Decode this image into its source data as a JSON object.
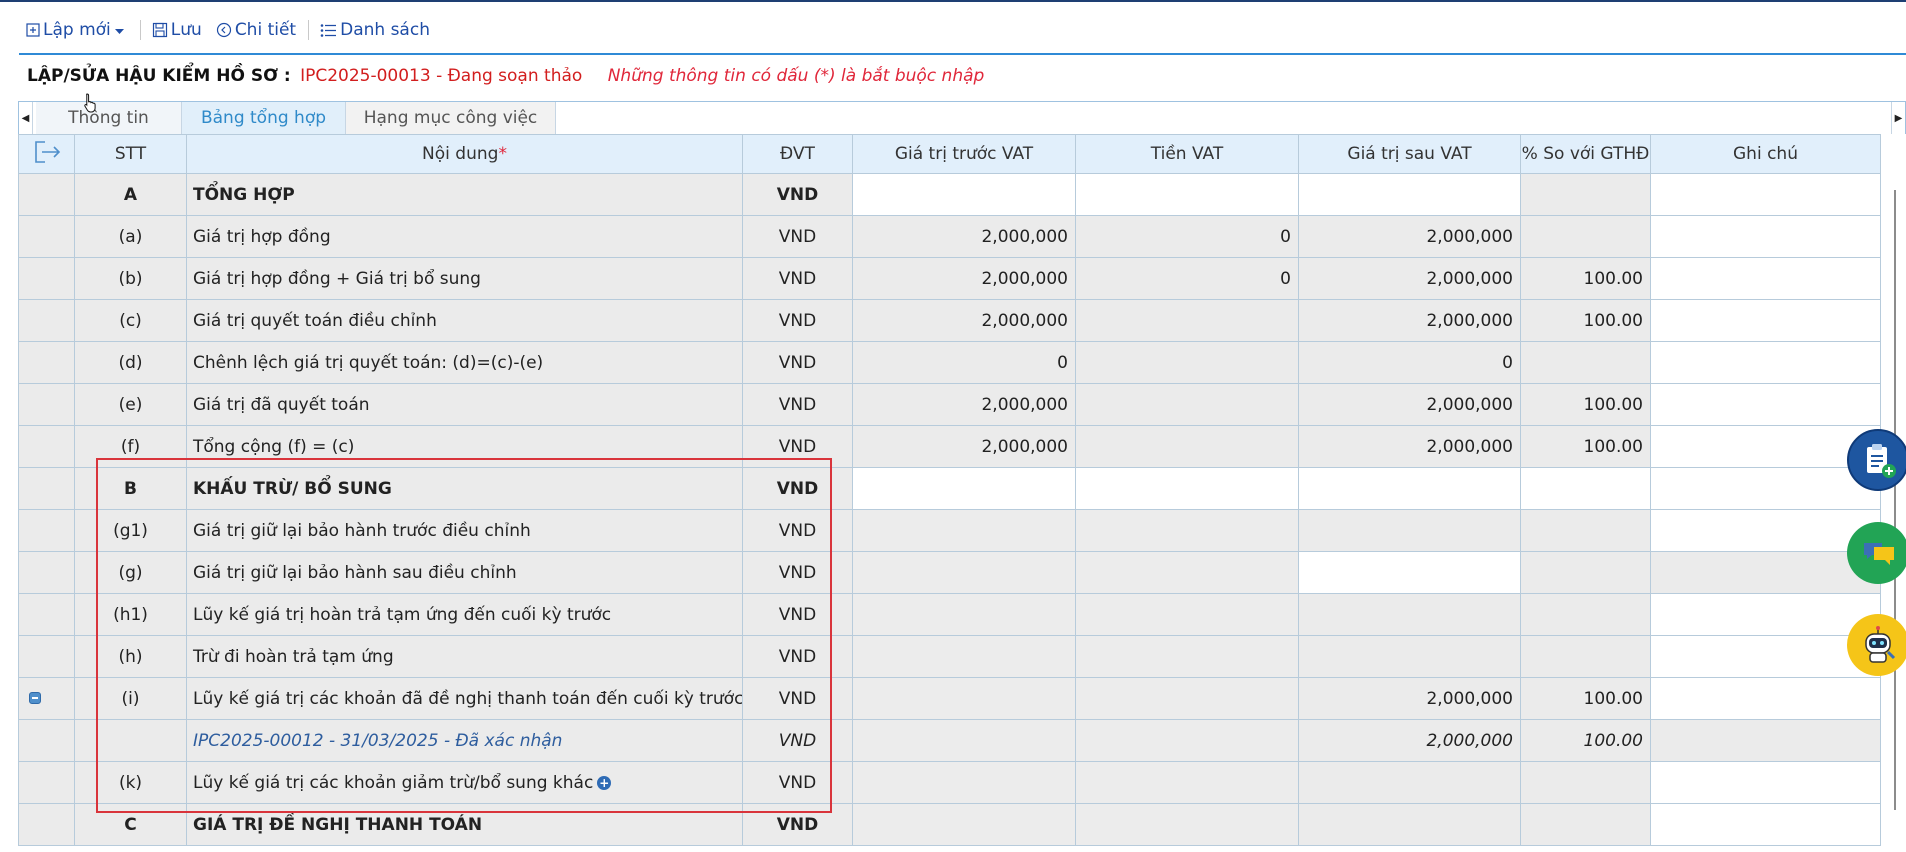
{
  "toolbar": {
    "new_label": "Lập mới",
    "save_label": "Lưu",
    "detail_label": "Chi tiết",
    "list_label": "Danh sách"
  },
  "header": {
    "title": "LẬP/SỬA HẬU KIỂM HỒ SƠ :",
    "record": "IPC2025-00013 - Đang soạn thảo",
    "required_note": "Những thông tin có dấu (*) là bắt buộc nhập"
  },
  "tabs": [
    {
      "label": "Thông tin"
    },
    {
      "label": "Bảng tổng hợp"
    },
    {
      "label": "Hạng mục công việc"
    }
  ],
  "columns": {
    "stt": "STT",
    "content": "Nội dung",
    "required_mark": "*",
    "unit": "ĐVT",
    "pre_vat": "Giá trị trước VAT",
    "vat": "Tiền VAT",
    "post_vat": "Giá trị sau VAT",
    "pct": "% So với GTHĐ",
    "note": "Ghi chú"
  },
  "rows": [
    {
      "stt": "A",
      "content": "TỔNG HỢP",
      "unit": "VND",
      "pre_vat": "",
      "vat": "",
      "post_vat": "",
      "pct": "",
      "note": ""
    },
    {
      "stt": "(a)",
      "content": "Giá trị hợp đồng",
      "unit": "VND",
      "pre_vat": "2,000,000",
      "vat": "0",
      "post_vat": "2,000,000",
      "pct": "",
      "note": ""
    },
    {
      "stt": "(b)",
      "content": "Giá trị hợp đồng + Giá trị bổ sung",
      "unit": "VND",
      "pre_vat": "2,000,000",
      "vat": "0",
      "post_vat": "2,000,000",
      "pct": "100.00",
      "note": ""
    },
    {
      "stt": "(c)",
      "content": "Giá trị quyết toán điều chỉnh",
      "unit": "VND",
      "pre_vat": "2,000,000",
      "vat": "",
      "post_vat": "2,000,000",
      "pct": "100.00",
      "note": ""
    },
    {
      "stt": "(d)",
      "content": "Chênh lệch giá trị quyết toán: (d)=(c)-(e)",
      "unit": "VND",
      "pre_vat": "0",
      "vat": "",
      "post_vat": "0",
      "pct": "",
      "note": ""
    },
    {
      "stt": "(e)",
      "content": "Giá trị đã quyết toán",
      "unit": "VND",
      "pre_vat": "2,000,000",
      "vat": "",
      "post_vat": "2,000,000",
      "pct": "100.00",
      "note": ""
    },
    {
      "stt": "(f)",
      "content": "Tổng cộng (f) = (c)",
      "unit": "VND",
      "pre_vat": "2,000,000",
      "vat": "",
      "post_vat": "2,000,000",
      "pct": "100.00",
      "note": ""
    },
    {
      "stt": "B",
      "content": "KHẤU TRỪ/ BỔ SUNG",
      "unit": "VND",
      "pre_vat": "",
      "vat": "",
      "post_vat": "",
      "pct": "",
      "note": ""
    },
    {
      "stt": "(g1)",
      "content": "Giá trị giữ lại bảo hành trước điều chỉnh",
      "unit": "VND",
      "pre_vat": "",
      "vat": "",
      "post_vat": "",
      "pct": "",
      "note": ""
    },
    {
      "stt": "(g)",
      "content": "Giá trị giữ lại bảo hành sau điều chỉnh",
      "unit": "VND",
      "pre_vat": "",
      "vat": "",
      "post_vat": "",
      "pct": "",
      "note": ""
    },
    {
      "stt": "(h1)",
      "content": "Lũy kế giá trị hoàn trả tạm ứng đến cuối kỳ trước",
      "unit": "VND",
      "pre_vat": "",
      "vat": "",
      "post_vat": "",
      "pct": "",
      "note": ""
    },
    {
      "stt": "(h)",
      "content": "Trừ đi hoàn trả tạm ứng",
      "unit": "VND",
      "pre_vat": "",
      "vat": "",
      "post_vat": "",
      "pct": "",
      "note": ""
    },
    {
      "stt": "(i)",
      "content": "Lũy kế giá trị các khoản đã đề nghị thanh toán đến cuối kỳ trước",
      "unit": "VND",
      "pre_vat": "",
      "vat": "",
      "post_vat": "2,000,000",
      "pct": "100.00",
      "note": ""
    },
    {
      "stt": "",
      "content": "IPC2025-00012 - 31/03/2025 - Đã xác nhận",
      "unit": "VND",
      "pre_vat": "",
      "vat": "",
      "post_vat": "2,000,000",
      "pct": "100.00",
      "note": ""
    },
    {
      "stt": "(k)",
      "content": "Lũy kế giá trị các khoản giảm trừ/bổ sung khác",
      "unit": "VND",
      "pre_vat": "",
      "vat": "",
      "post_vat": "",
      "pct": "",
      "note": ""
    },
    {
      "stt": "C",
      "content": "GIÁ TRỊ ĐỀ NGHỊ THANH TOÁN",
      "unit": "VND",
      "pre_vat": "",
      "vat": "",
      "post_vat": "",
      "pct": "",
      "note": ""
    }
  ],
  "colors": {
    "accent": "#2f8ad6",
    "header_bg": "#e1effb",
    "row_bg": "#ebebeb",
    "highlight_border": "#d9343b",
    "required_text": "#e0273a"
  },
  "icons": {
    "new": "file-plus-icon",
    "save": "floppy-disk-icon",
    "detail": "circle-arrow-left-icon",
    "list": "list-icon",
    "export": "export-arrow-icon",
    "expand_row": "plus-circle-icon",
    "collapse_row": "minus-square-icon",
    "fab_note": "clipboard-add-icon",
    "fab_chat": "chat-bubbles-icon",
    "fab_bot": "robot-support-icon"
  }
}
